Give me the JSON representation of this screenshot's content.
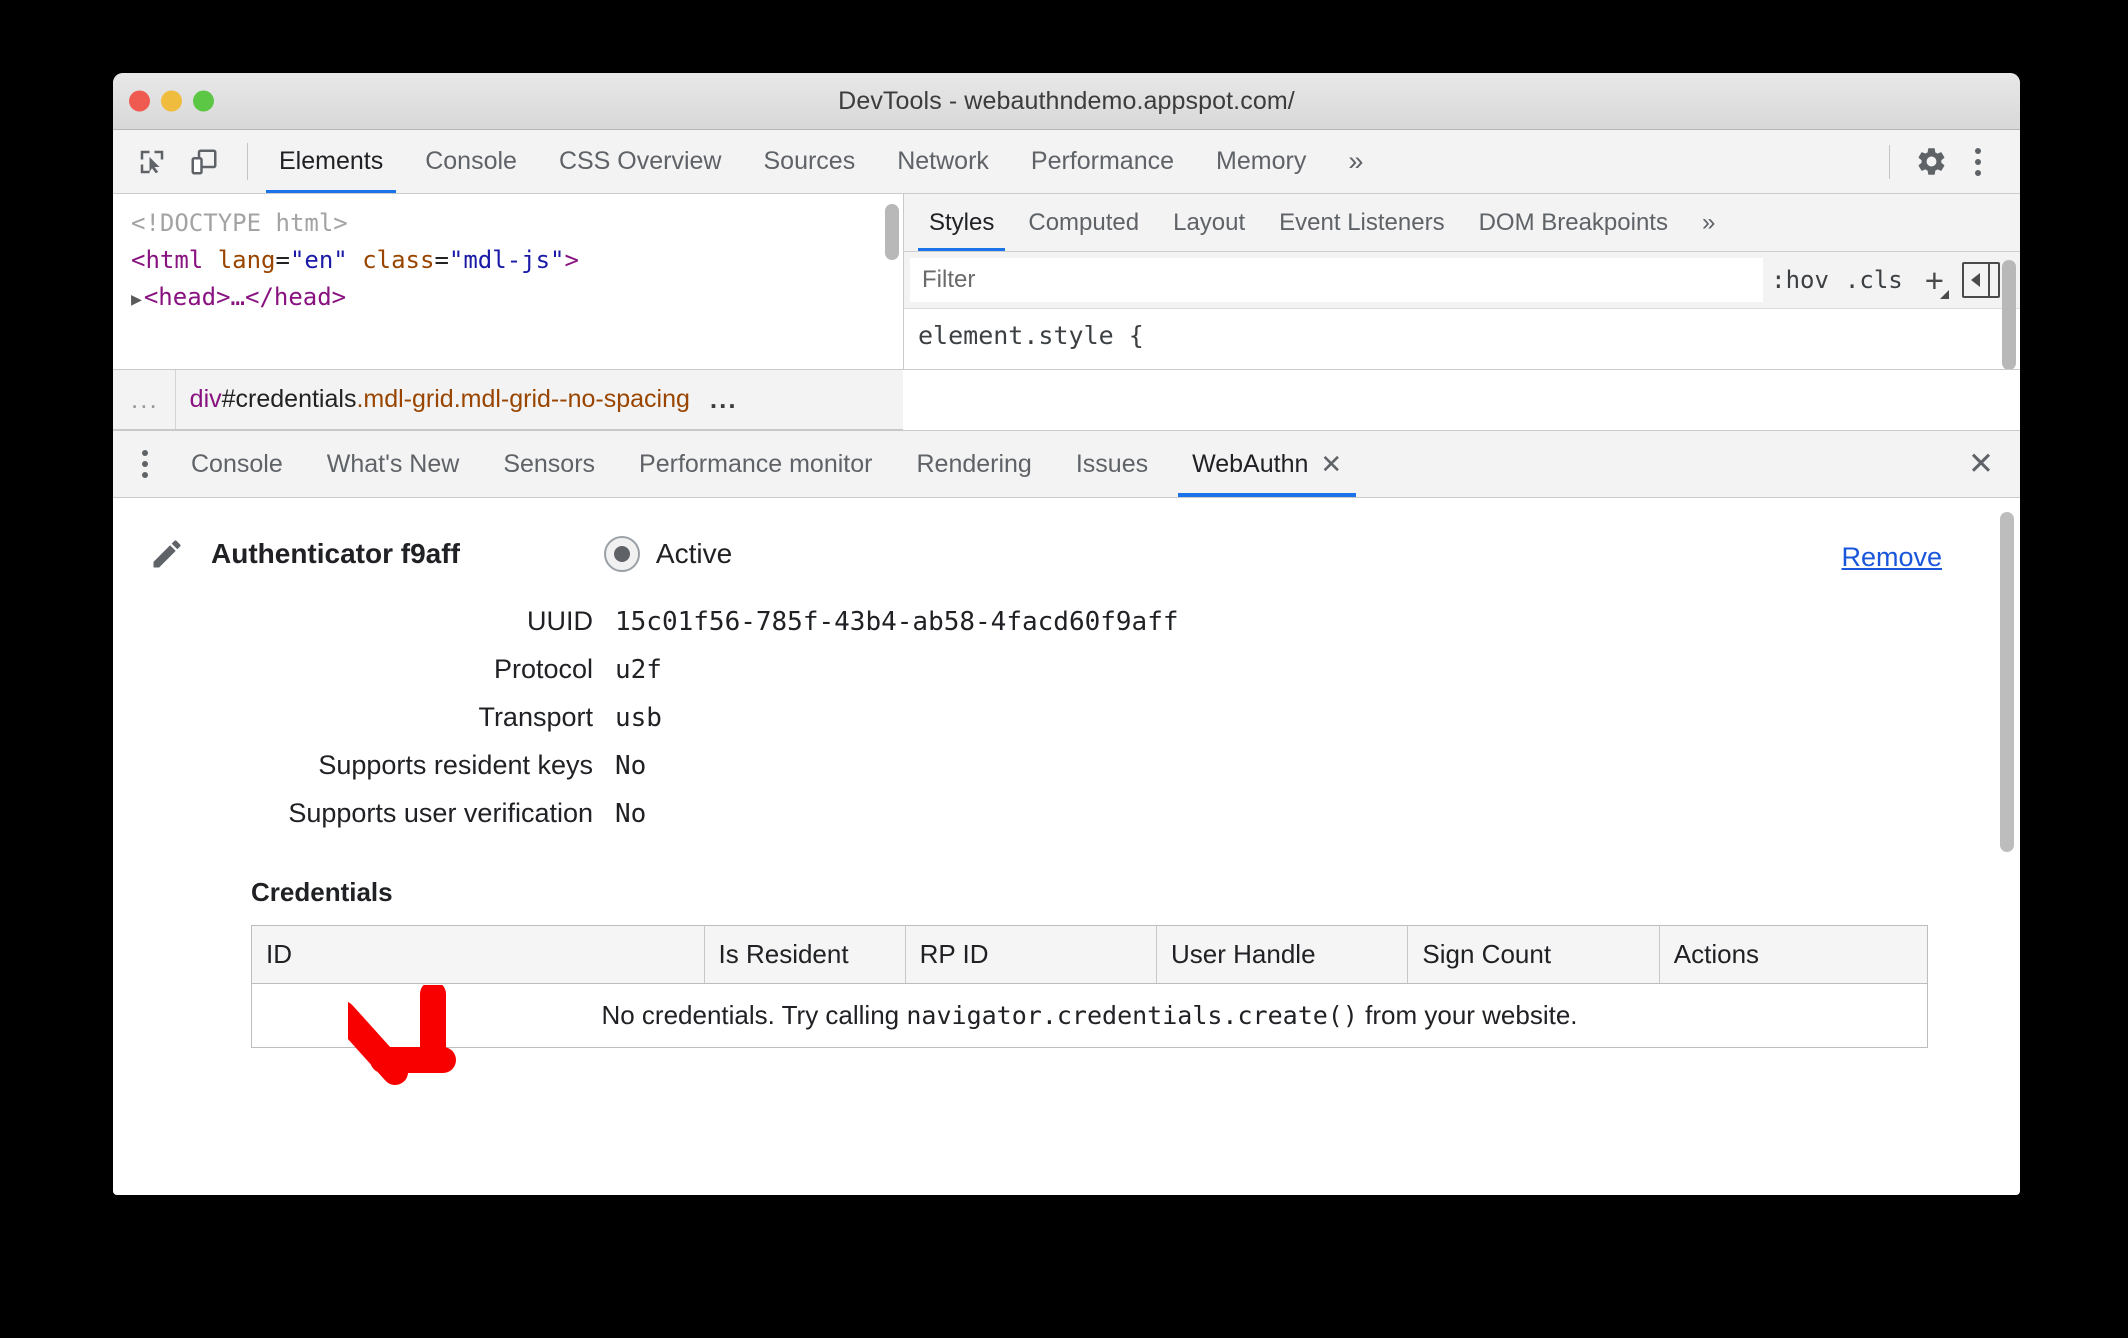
{
  "window": {
    "title": "DevTools - webauthndemo.appspot.com/",
    "traffic_lights": [
      "close-button",
      "minimize-button",
      "maximize-button"
    ]
  },
  "main_toolbar": {
    "icons": [
      {
        "name": "inspect-element-icon",
        "label": "Inspect element"
      },
      {
        "name": "device-toolbar-icon",
        "label": "Toggle device toolbar"
      }
    ],
    "tabs": [
      {
        "label": "Elements",
        "active": true
      },
      {
        "label": "Console",
        "active": false
      },
      {
        "label": "CSS Overview",
        "active": false
      },
      {
        "label": "Sources",
        "active": false
      },
      {
        "label": "Network",
        "active": false
      },
      {
        "label": "Performance",
        "active": false
      },
      {
        "label": "Memory",
        "active": false
      }
    ],
    "more_tabs_label": "»",
    "settings_label": "Settings",
    "more_options_label": "Customize and control DevTools"
  },
  "dom_tree": {
    "lines": [
      {
        "kind": "doctype",
        "text": "<!DOCTYPE html>"
      },
      {
        "kind": "html_open",
        "tag_open": "<html",
        "attr1": "lang",
        "val1": "\"en\"",
        "attr2": "class",
        "val2": "\"mdl-js\"",
        "tag_close": ">"
      },
      {
        "kind": "head",
        "arrow": "▶",
        "text": "<head>…</head>"
      }
    ]
  },
  "breadcrumb": {
    "leading_ellipsis": "...",
    "tag": "div",
    "id": "#credentials",
    "classes": ".mdl-grid.mdl-grid--no-spacing",
    "trailing_ellipsis": "..."
  },
  "styles_sidebar": {
    "tabs": [
      {
        "label": "Styles",
        "active": true
      },
      {
        "label": "Computed",
        "active": false
      },
      {
        "label": "Layout",
        "active": false
      },
      {
        "label": "Event Listeners",
        "active": false
      },
      {
        "label": "DOM Breakpoints",
        "active": false
      }
    ],
    "more_tabs_label": "»",
    "filter_placeholder": "Filter",
    "filter_value": "",
    "hov_label": ":hov",
    "cls_label": ".cls",
    "new_rule_label": "+",
    "toggle_sidebar_label": "Toggle sidebar",
    "element_style_rule": "element.style {"
  },
  "drawer": {
    "tabs": [
      {
        "label": "Console",
        "active": false,
        "closable": false
      },
      {
        "label": "What's New",
        "active": false,
        "closable": false
      },
      {
        "label": "Sensors",
        "active": false,
        "closable": false
      },
      {
        "label": "Performance monitor",
        "active": false,
        "closable": false
      },
      {
        "label": "Rendering",
        "active": false,
        "closable": false
      },
      {
        "label": "Issues",
        "active": false,
        "closable": false
      },
      {
        "label": "WebAuthn",
        "active": true,
        "closable": true,
        "close_glyph": "✕"
      }
    ],
    "more_options_label": "More tools",
    "close_drawer_glyph": "✕"
  },
  "webauthn": {
    "authenticator": {
      "edit_icon_label": "Edit name",
      "title": "Authenticator f9aff",
      "active_label": "Active",
      "active_selected": true,
      "remove_label": "Remove"
    },
    "fields": [
      {
        "label": "UUID",
        "value": "15c01f56-785f-43b4-ab58-4facd60f9aff"
      },
      {
        "label": "Protocol",
        "value": "u2f"
      },
      {
        "label": "Transport",
        "value": "usb"
      },
      {
        "label": "Supports resident keys",
        "value": "No"
      },
      {
        "label": "Supports user verification",
        "value": "No"
      }
    ],
    "credentials": {
      "heading": "Credentials",
      "columns": [
        "ID",
        "Is Resident",
        "RP ID",
        "User Handle",
        "Sign Count",
        "Actions"
      ],
      "rows": [],
      "empty_message_prefix": "No credentials. Try calling ",
      "empty_message_code": "navigator.credentials.create()",
      "empty_message_suffix": " from your website."
    }
  },
  "annotation": {
    "arrow": {
      "name": "red-arrow-annotation",
      "color": "#f90000",
      "direction": "down-right"
    }
  },
  "colors": {
    "accent": "#1a73e8",
    "link": "#1a56db",
    "annotation_red": "#f90000",
    "tag_purple": "#881280",
    "attr_orange": "#994500",
    "value_blue": "#1a1aa6"
  }
}
